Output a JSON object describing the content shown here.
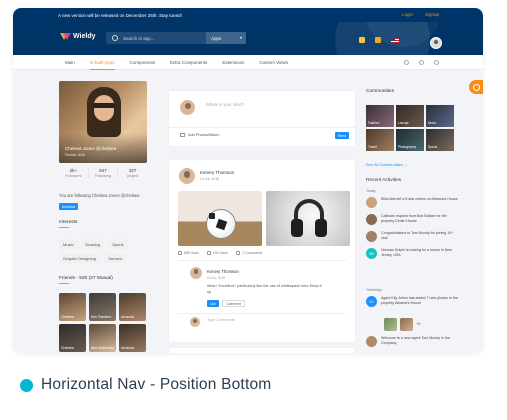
{
  "announcement": {
    "text": "A new version will be released on December 25th. Stay tuned!",
    "links": [
      "Login",
      "Signup"
    ]
  },
  "header": {
    "app_name": "Wieldy",
    "search_placeholder": "Search in app...",
    "apps_label": "Apps"
  },
  "nav": {
    "items": [
      "Main",
      "In-built Apps",
      "Components",
      "Extra Components",
      "Extensions",
      "Custom Views"
    ],
    "active": "In-built Apps"
  },
  "profile": {
    "name": "Chelsea Jones @chelsea",
    "location": "Florida, USA",
    "stats": [
      {
        "value": "2k+",
        "label": "Followers"
      },
      {
        "value": "847",
        "label": "Following"
      },
      {
        "value": "327",
        "label": "project"
      }
    ],
    "following_text": "You are following Chelsea Jones @chelsea",
    "unfollow_label": "Unfollow"
  },
  "interests": {
    "title": "Interests",
    "items": [
      "Music",
      "Drawing",
      "Sports",
      "Graphic Designing",
      "Tourism"
    ]
  },
  "friends": {
    "title": "Friends - 530 (27 Mutual)",
    "items": [
      "Chelsea",
      "Ken Ramirez",
      "Amanda",
      "Chelsea",
      "Alex Mcdonald",
      "Amanda"
    ]
  },
  "composer": {
    "placeholder": "Whats in your mind?",
    "add_label": "Add Photos/Album",
    "send_label": "Send"
  },
  "post": {
    "author": "Kenery Thomson",
    "date": "24 Jul, 2018",
    "likes": "89K likes",
    "views": "190 Likes",
    "comments": "1 Comments",
    "comment": {
      "author": "Kenery Thomson",
      "date": "24 Jul, 2018",
      "text": "Wow ! Excellent ! particularly like the use of whitespace here Keep it up",
      "like_label": "Like",
      "comment_label": "Comment"
    },
    "type_placeholder": "Type Comments"
  },
  "communities": {
    "title": "Communities",
    "items": [
      "Fashion",
      "Lounge",
      "Music",
      "Travel",
      "Photography",
      "Sports"
    ],
    "see_all": "See All Communities"
  },
  "recent_activities": {
    "title": "Recent Activities",
    "days": [
      "Today",
      "Yesterday"
    ],
    "today": [
      {
        "initials": "",
        "text": "Mila Alba left a 5 star review on Albama's House"
      },
      {
        "initials": "",
        "text": "Callback request from Bob Builder for the property Dimitri House"
      },
      {
        "initials": "",
        "text": "Congratulations to Tom Moody for joining 10+ club"
      },
      {
        "initials": "ND",
        "text": "Norman Dolphi is looking for a house in New Jersey, USA"
      }
    ],
    "yesterday": [
      {
        "initials": "KJ",
        "text": "Agent Kily Johns has added 7 new photos to the property Albama's House"
      },
      {
        "initials": "",
        "text": "Welcome to a new agent Tom Moody in the Company"
      }
    ],
    "more_photos": "+6"
  },
  "caption": {
    "text": "Horizontal Nav - Position Bottom"
  },
  "colors": {
    "header": "#003366",
    "accent": "#fa8c16",
    "primary": "#1890ff",
    "caption_dot": "#00b8d4"
  }
}
